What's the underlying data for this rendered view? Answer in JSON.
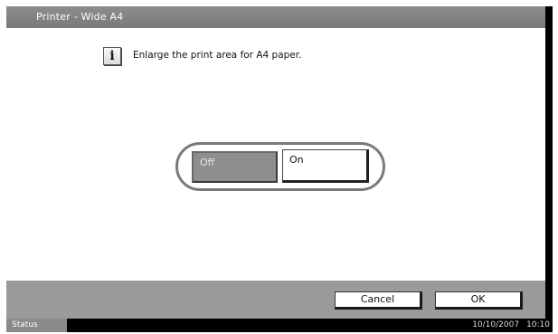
{
  "window": {
    "title": "Printer - Wide A4"
  },
  "message": {
    "icon": "info-icon",
    "icon_glyph": "i",
    "text": "Enlarge the print area for A4 paper."
  },
  "options": [
    {
      "label": "Off",
      "selected": true
    },
    {
      "label": "On",
      "selected": false
    }
  ],
  "footer": {
    "cancel_label": "Cancel",
    "ok_label": "OK"
  },
  "statusbar": {
    "status_label": "Status",
    "date": "10/10/2007",
    "time": "10:10"
  },
  "colors": {
    "selected_button": "#8e8e8e",
    "titlebar": "#808080",
    "bottombar": "#9a9a9a"
  }
}
